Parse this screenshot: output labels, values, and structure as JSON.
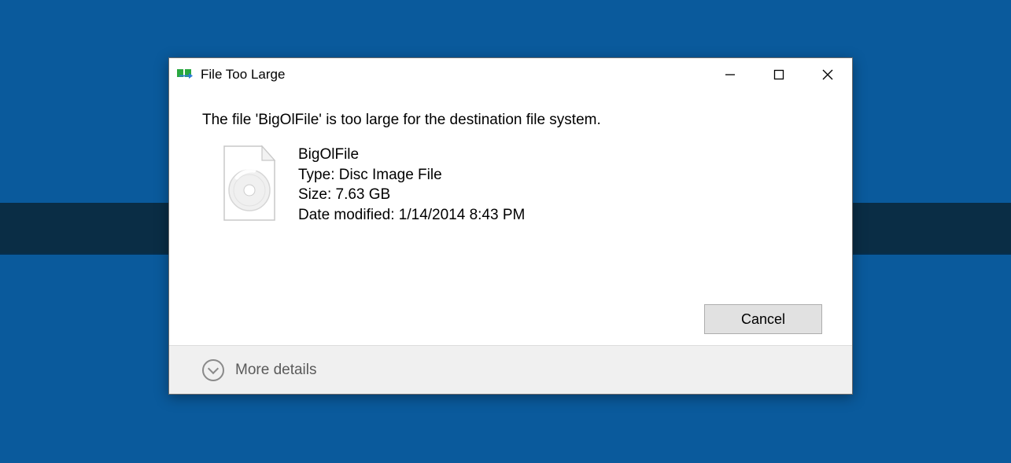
{
  "window": {
    "title": "File Too Large"
  },
  "message": "The file 'BigOlFile' is too large for the destination file system.",
  "file": {
    "name": "BigOlFile",
    "type_label": "Type: Disc Image File",
    "size_label": "Size: 7.63 GB",
    "date_label": "Date modified: 1/14/2014 8:43 PM"
  },
  "buttons": {
    "cancel": "Cancel"
  },
  "footer": {
    "more_details": "More details"
  }
}
